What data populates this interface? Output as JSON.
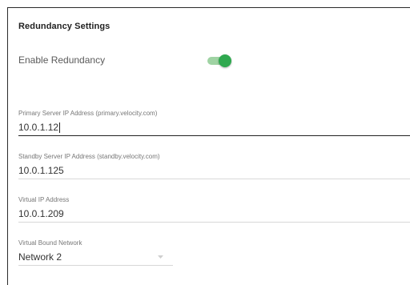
{
  "panel": {
    "title": "Redundancy Settings"
  },
  "redundancy": {
    "label": "Enable Redundancy",
    "enabled": true,
    "toggle_color": "#2fa84f"
  },
  "primary_ip": {
    "label": "Primary Server IP Address (primary.velocity.com)",
    "value": "10.0.1.12"
  },
  "standby_ip": {
    "label": "Standby Server IP Address (standby.velocity.com)",
    "value": "10.0.1.125"
  },
  "virtual_ip": {
    "label": "Virtual IP Address",
    "value": "10.0.1.209"
  },
  "bound_network": {
    "label": "Virtual Bound Network",
    "value": "Network 2",
    "icon": "chevron-down-icon"
  }
}
